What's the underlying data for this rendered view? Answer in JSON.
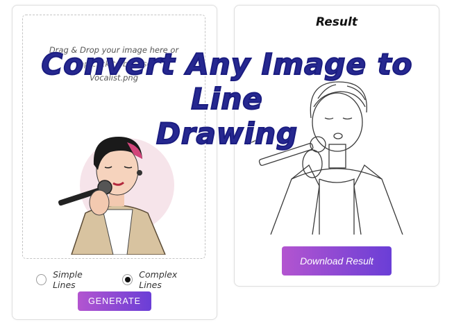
{
  "overlay": {
    "title_line1": "Convert Any Image to Line",
    "title_line2": "Drawing"
  },
  "upload": {
    "instruction_line1": "Drag & Drop your image here or",
    "instruction_line2": "tap/click to browse",
    "filename": "Vocalist.png"
  },
  "options": {
    "simple_label": "Simple Lines",
    "complex_label": "Complex Lines",
    "selected": "Complex Lines"
  },
  "generate_button": {
    "label": "GENERATE"
  },
  "result": {
    "title": "Result",
    "download_label": "Download Result"
  },
  "colors": {
    "button_gradient_start": "#b355d0",
    "button_gradient_end": "#6a3ed6",
    "overlay_text": "#262890"
  }
}
